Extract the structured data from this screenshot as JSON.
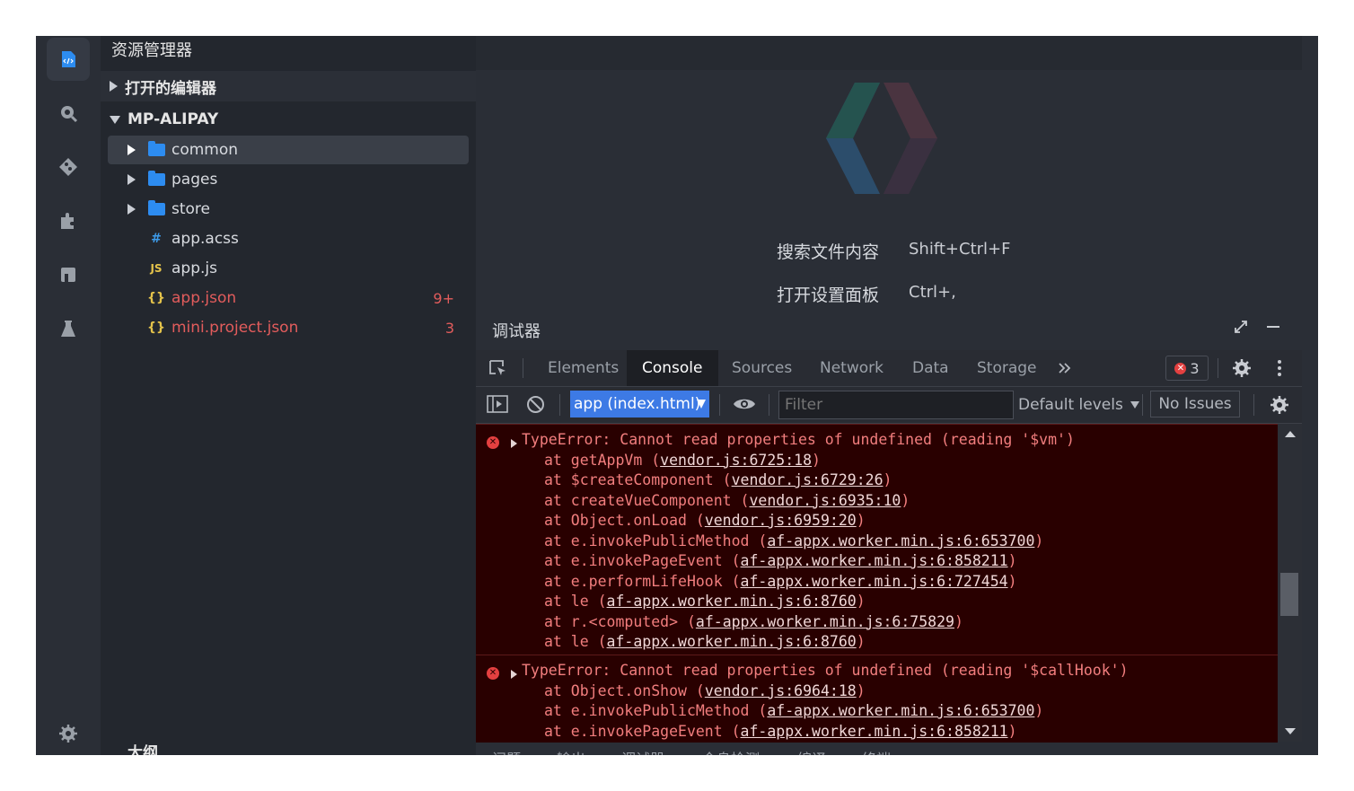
{
  "sidebar": {
    "title": "资源管理器",
    "open_editors_label": "打开的编辑器",
    "project_label": "MP-ALIPAY",
    "outline_label": "大纲",
    "tree": [
      {
        "name": "common",
        "type": "folder"
      },
      {
        "name": "pages",
        "type": "folder"
      },
      {
        "name": "store",
        "type": "folder"
      },
      {
        "name": "app.acss",
        "type": "file",
        "icon_text": "#"
      },
      {
        "name": "app.js",
        "type": "file",
        "icon_text": "JS"
      },
      {
        "name": "app.json",
        "type": "file",
        "icon_text": "{}",
        "badge": "9+"
      },
      {
        "name": "mini.project.json",
        "type": "file",
        "icon_text": "{}",
        "badge": "3"
      }
    ]
  },
  "welcome": {
    "shortcuts": [
      {
        "label": "搜索文件内容",
        "keys": "Shift+Ctrl+F"
      },
      {
        "label": "打开设置面板",
        "keys": "Ctrl+,"
      }
    ]
  },
  "debugger": {
    "title": "调试器",
    "tabs": [
      "Elements",
      "Console",
      "Sources",
      "Network",
      "Data",
      "Storage"
    ],
    "active_tab": "Console",
    "error_count": "3",
    "context": "app (index.html)",
    "filter_placeholder": "Filter",
    "levels": "Default levels",
    "issues": "No Issues"
  },
  "console": {
    "entries": [
      {
        "message": "TypeError: Cannot read properties of undefined (reading '$vm')",
        "stack": [
          {
            "fn": "getAppVm",
            "loc": "vendor.js:6725:18"
          },
          {
            "fn": "$createComponent",
            "loc": "vendor.js:6729:26"
          },
          {
            "fn": "createVueComponent",
            "loc": "vendor.js:6935:10"
          },
          {
            "fn": "Object.onLoad",
            "loc": "vendor.js:6959:20"
          },
          {
            "fn": "e.invokePublicMethod",
            "loc": "af-appx.worker.min.js:6:653700"
          },
          {
            "fn": "e.invokePageEvent",
            "loc": "af-appx.worker.min.js:6:858211"
          },
          {
            "fn": "e.performLifeHook",
            "loc": "af-appx.worker.min.js:6:727454"
          },
          {
            "fn": "le",
            "loc": "af-appx.worker.min.js:6:8760"
          },
          {
            "fn": "r.<computed>",
            "loc": "af-appx.worker.min.js:6:75829"
          },
          {
            "fn": "le",
            "loc": "af-appx.worker.min.js:6:8760"
          }
        ]
      },
      {
        "message": "TypeError: Cannot read properties of undefined (reading '$callHook')",
        "stack": [
          {
            "fn": "Object.onShow",
            "loc": "vendor.js:6964:18"
          },
          {
            "fn": "e.invokePublicMethod",
            "loc": "af-appx.worker.min.js:6:653700"
          },
          {
            "fn": "e.invokePageEvent",
            "loc": "af-appx.worker.min.js:6:858211"
          }
        ]
      }
    ]
  },
  "bottom_tabs": [
    "问题",
    "输出",
    "调试器",
    "全息检测",
    "编译",
    "终端"
  ],
  "colors": {
    "accent": "#2d8cf0",
    "error": "#e34040",
    "error_bg": "#290000",
    "select_bg": "#3d7ae5"
  },
  "icons": [
    "explorer-icon",
    "search-icon",
    "source-control-icon",
    "extensions-icon",
    "dashboard-icon",
    "flask-icon",
    "settings-icon"
  ]
}
